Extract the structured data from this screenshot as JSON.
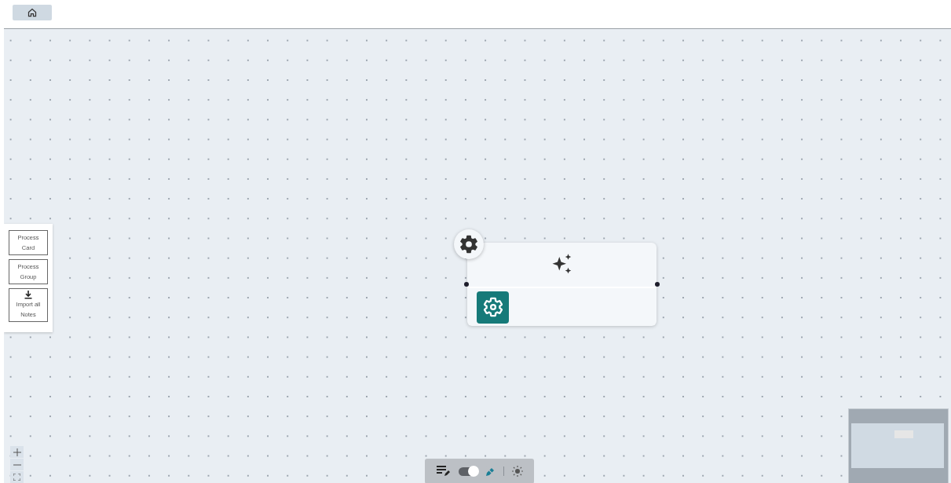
{
  "left_panel": {
    "buttons": [
      {
        "kind": "text",
        "label": "Process Card"
      },
      {
        "kind": "text",
        "label": "Process Group"
      },
      {
        "kind": "import",
        "label": "Import all Notes"
      }
    ]
  },
  "toolbar": {
    "toggle": {
      "on": true
    }
  }
}
